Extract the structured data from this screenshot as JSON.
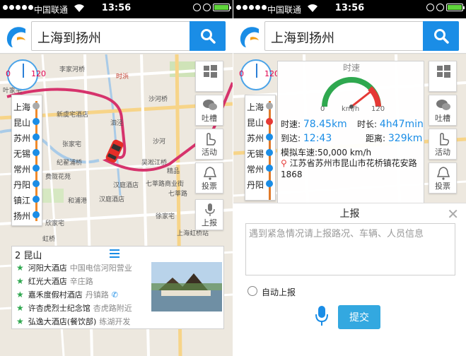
{
  "status_bar": {
    "carrier": "中国联通",
    "time": "13:56",
    "icons": [
      "signal-dots",
      "wifi-icon",
      "alarm-icon",
      "clock-icon",
      "battery-icon"
    ]
  },
  "header": {
    "search_value": "上海到扬州",
    "search_button_icon": "search-icon"
  },
  "mini_gauge": {
    "min": "0",
    "max": "120"
  },
  "cities": [
    "上海",
    "昆山",
    "苏州",
    "无锡",
    "常州",
    "丹阳",
    "镇江",
    "扬州"
  ],
  "tools_left": [
    {
      "label": "",
      "icon": "windows-icon"
    },
    {
      "label": "吐槽",
      "icon": "wechat-icon"
    },
    {
      "label": "活动",
      "icon": "hand-icon"
    },
    {
      "label": "投票",
      "icon": "bell-icon"
    },
    {
      "label": "上报",
      "icon": "mic-icon"
    }
  ],
  "tools_right": [
    {
      "label": "",
      "icon": "windows-icon"
    },
    {
      "label": "吐槽",
      "icon": "wechat-icon"
    },
    {
      "label": "活动",
      "icon": "hand-icon"
    },
    {
      "label": "投票",
      "icon": "bell-icon"
    }
  ],
  "map_labels_left": [
    "李家河桥",
    "叶家宅",
    "时浜",
    "沙河桥",
    "新虞宅酒店",
    "泗泾",
    "张家宅",
    "沙河",
    "纪翟浦桥",
    "吴淞江桥",
    "七莘路商业街",
    "费陇花苑",
    "汉庭酒店",
    "汉庭酒店",
    "欣家宅",
    "徐家宅",
    "上海虹桥站",
    "虹桥",
    "精品",
    "七莘路",
    "和浦港"
  ],
  "hotel_card": {
    "title": "2 昆山",
    "items": [
      {
        "name": "河阳大酒店",
        "sub": "中国电信河阳营业"
      },
      {
        "name": "红光大酒店",
        "sub": "辛庄路"
      },
      {
        "name": "嘉禾度假村酒店",
        "sub": "丹镇路"
      },
      {
        "name": "许杏虎烈士纪念馆",
        "sub": "杏虎路附近"
      },
      {
        "name": "弘逸大酒店(餐饮部)",
        "sub": "练湖开发"
      }
    ]
  },
  "info_panel": {
    "title": "时速",
    "gauge_min": "0",
    "gauge_unit": "km/h",
    "gauge_max": "120",
    "speed_label": "时速:",
    "speed_value": "78.45km",
    "duration_label": "时长:",
    "duration_value": "4h47min",
    "arrive_label": "到达:",
    "arrive_value": "12:43",
    "distance_label": "距离:",
    "distance_value": "329km",
    "sim_speed": "模拟车速:50,000 km/h",
    "address": "江苏省苏州市昆山市花桥镇花安路1868"
  },
  "report": {
    "title": "上报",
    "placeholder": "遇到紧急情况请上报路况、车辆、人员信息",
    "auto_label": "自动上报",
    "submit": "提交"
  },
  "colors": {
    "accent": "#1a8de6",
    "route": "#d6336c",
    "submit": "#33a8e0"
  }
}
